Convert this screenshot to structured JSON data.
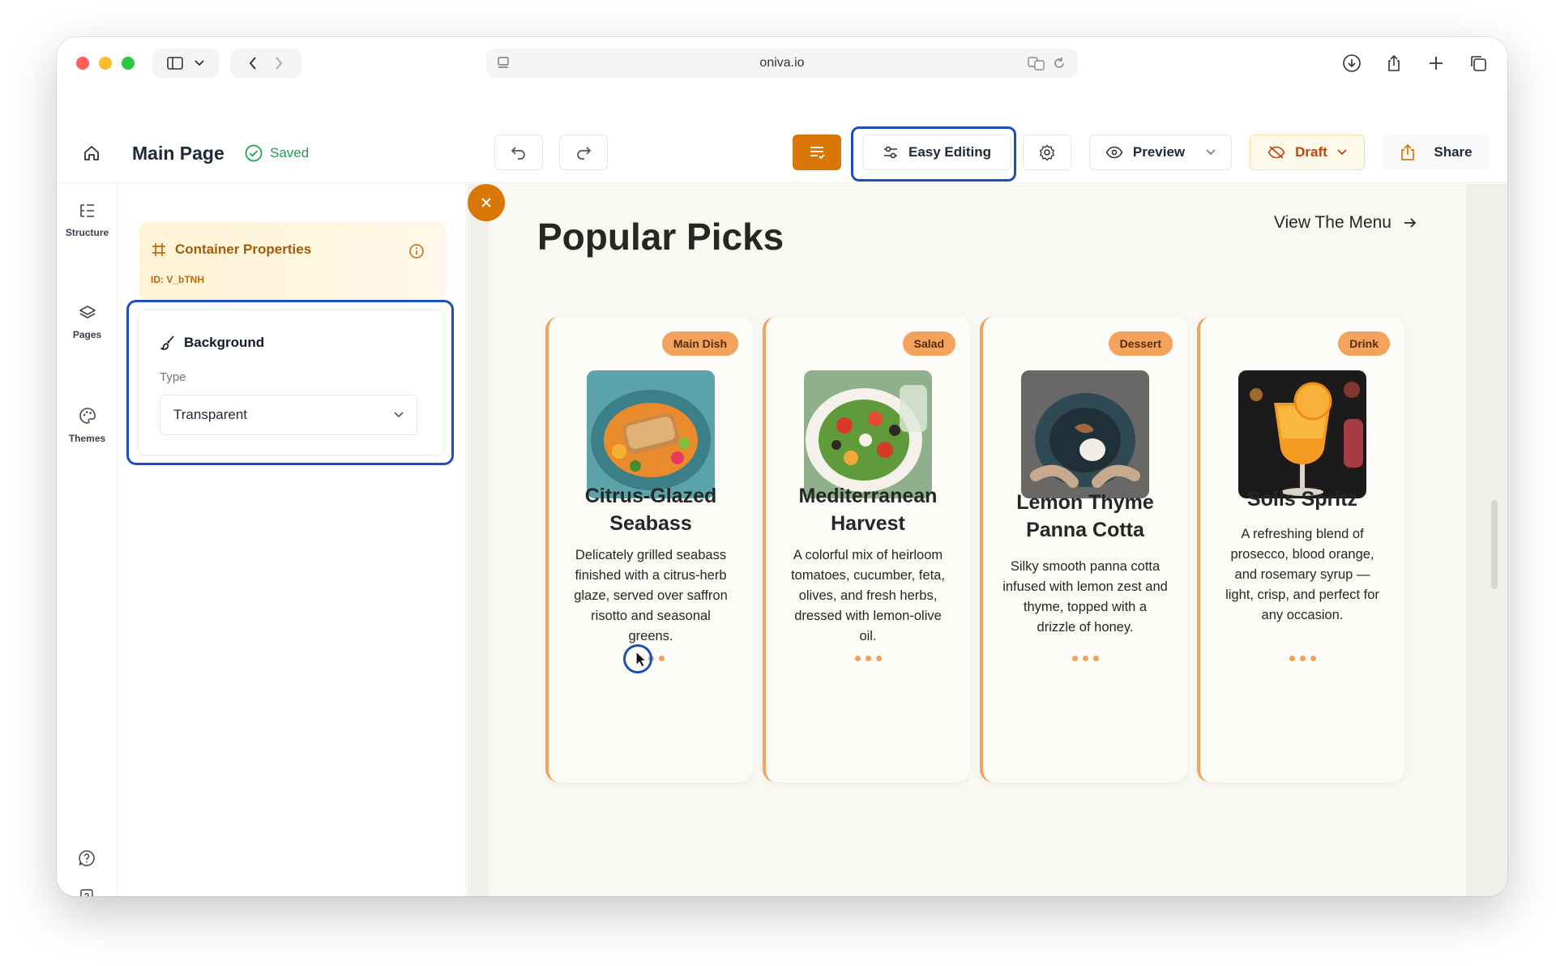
{
  "browser": {
    "url": "oniva.io"
  },
  "header": {
    "page_title": "Main Page",
    "saved_label": "Saved",
    "easy_editing_label": "Easy Editing",
    "preview_label": "Preview",
    "draft_label": "Draft",
    "share_label": "Share"
  },
  "rail": {
    "items": [
      {
        "label": "Structure",
        "icon": "structure-icon"
      },
      {
        "label": "Pages",
        "icon": "layers-icon"
      },
      {
        "label": "Themes",
        "icon": "palette-icon"
      }
    ]
  },
  "panel": {
    "title": "Container Properties",
    "id_label": "ID: V_bTNH",
    "background": {
      "title": "Background",
      "type_label": "Type",
      "type_value": "Transparent"
    }
  },
  "canvas": {
    "section_title": "Popular Picks",
    "view_menu_label": "View The Menu",
    "cards": [
      {
        "badge": "Main Dish",
        "title": "Citrus-Glazed Seabass",
        "description": "Delicately grilled seabass finished with a citrus-herb glaze, served over saffron risotto and seasonal greens."
      },
      {
        "badge": "Salad",
        "title": "Mediterranean Harvest",
        "description": "A colorful mix of heirloom tomatoes, cucumber, feta, olives, and fresh herbs, dressed with lemon-olive oil."
      },
      {
        "badge": "Dessert",
        "title": "Lemon Thyme Panna Cotta",
        "description": "Silky smooth panna cotta infused with lemon zest and thyme, topped with a drizzle of honey."
      },
      {
        "badge": "Drink",
        "title": "Solis Spritz",
        "description": "A refreshing blend of prosecco, blood orange, and rosemary syrup — light, crisp, and perfect for any occasion."
      }
    ]
  },
  "colors": {
    "accent": "#d97706",
    "highlight": "#1e4fb8",
    "saved": "#16a34a",
    "card_border": "#f0a35a"
  }
}
